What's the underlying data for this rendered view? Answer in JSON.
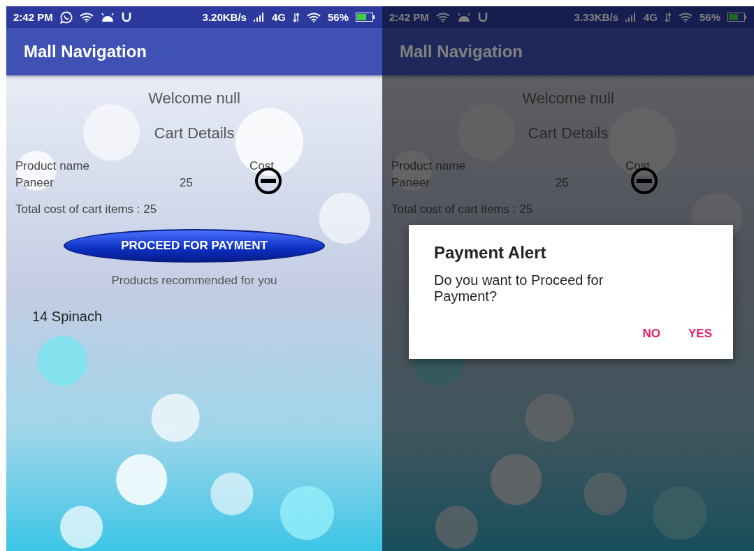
{
  "screens": [
    {
      "dimmed": false,
      "status_bar": {
        "time": "2:42 PM",
        "notifications": [
          {
            "kind": "whatsapp"
          },
          {
            "kind": "wifi"
          },
          {
            "kind": "android"
          },
          {
            "kind": "u"
          }
        ],
        "speed": "3.20KB/s",
        "network": "4G",
        "battery": "56%"
      },
      "app_bar": {
        "title": "Mall Navigation"
      },
      "welcome": "Welcome null",
      "cart_title": "Cart Details",
      "columns": [
        "Product name",
        "Cost"
      ],
      "items": [
        {
          "name": "Paneer",
          "cost": "25"
        }
      ],
      "total": "Total cost of cart items : 25",
      "proceed_button": "PROCEED FOR PAYMENT",
      "recommend_heading": "Products recommended for you",
      "recommendations": [
        "14 Spinach"
      ]
    },
    {
      "dimmed": true,
      "status_bar": {
        "time": "2:42 PM",
        "notifications": [
          {
            "kind": "wifi"
          },
          {
            "kind": "android"
          },
          {
            "kind": "u"
          }
        ],
        "speed": "3.33KB/s",
        "network": "4G",
        "battery": "56%"
      },
      "app_bar": {
        "title": "Mall Navigation"
      },
      "welcome": "Welcome null",
      "cart_title": "Cart Details",
      "columns": [
        "Product name",
        "Cost"
      ],
      "items": [
        {
          "name": "Paneer",
          "cost": "25"
        }
      ],
      "total": "Total cost of cart items : 25",
      "dialog": {
        "title": "Payment Alert",
        "message": "Do you want to Proceed for Payment?",
        "buttons": [
          "NO",
          "YES"
        ]
      }
    }
  ]
}
